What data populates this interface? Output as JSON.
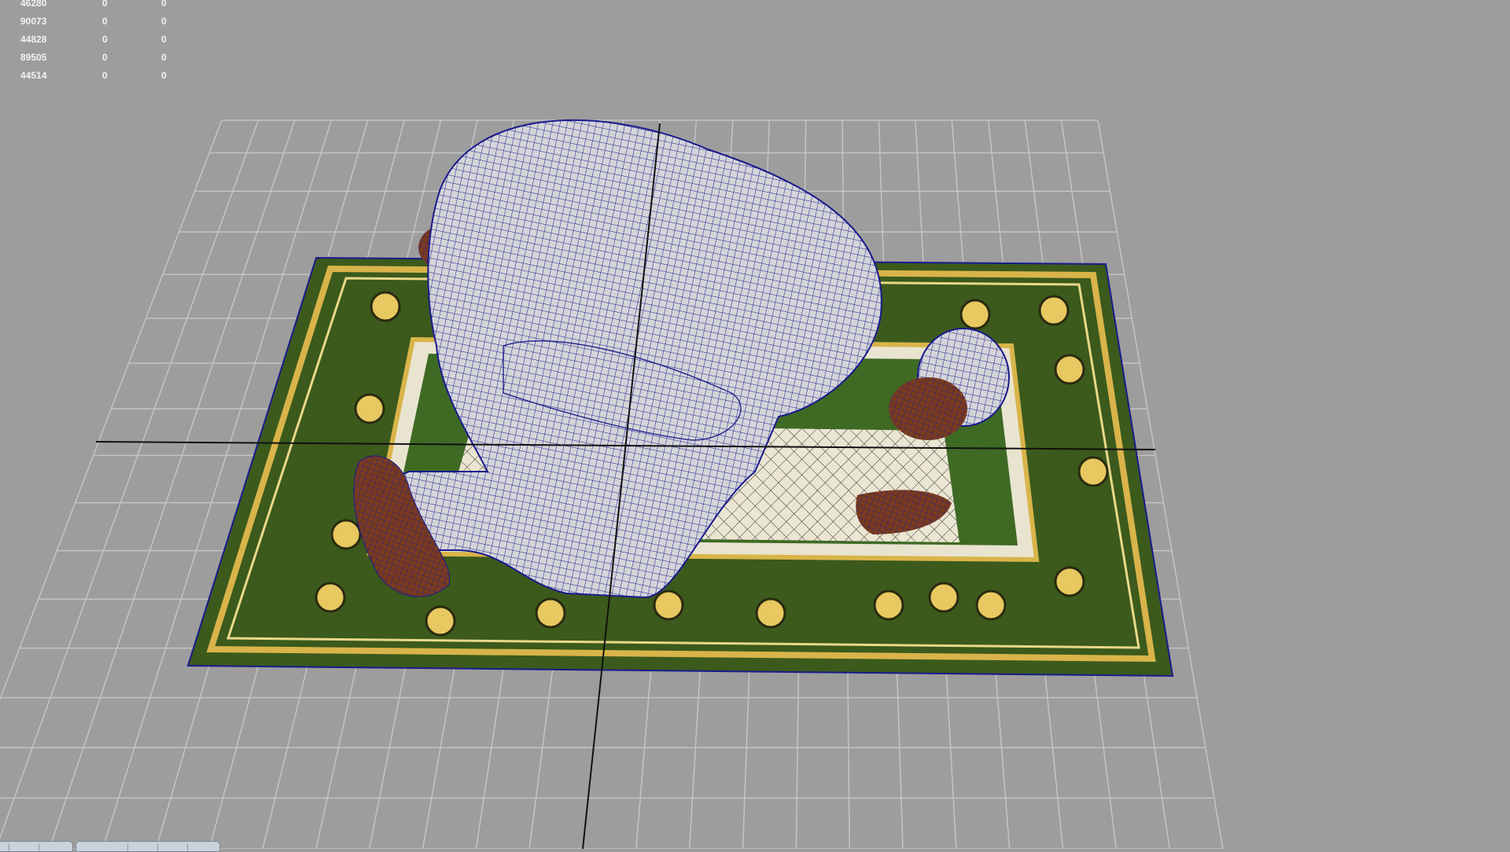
{
  "viewport": {
    "name": "3D perspective viewport",
    "background": "#9d9d9d",
    "grid_color": "#c4c4c4",
    "axis_color": "#111111",
    "wire_color": "#1a1a8c"
  },
  "stats": {
    "rows": [
      [
        "46280",
        "0",
        "0"
      ],
      [
        "90073",
        "0",
        "0"
      ],
      [
        "44828",
        "0",
        "0"
      ],
      [
        "89505",
        "0",
        "0"
      ],
      [
        "44514",
        "0",
        "0"
      ]
    ]
  },
  "scene": {
    "rug_colors": {
      "field": "#3b5a1c",
      "border": "#d9b44a",
      "center": "#e8e4d2"
    },
    "model": "praying figure wireframe"
  }
}
